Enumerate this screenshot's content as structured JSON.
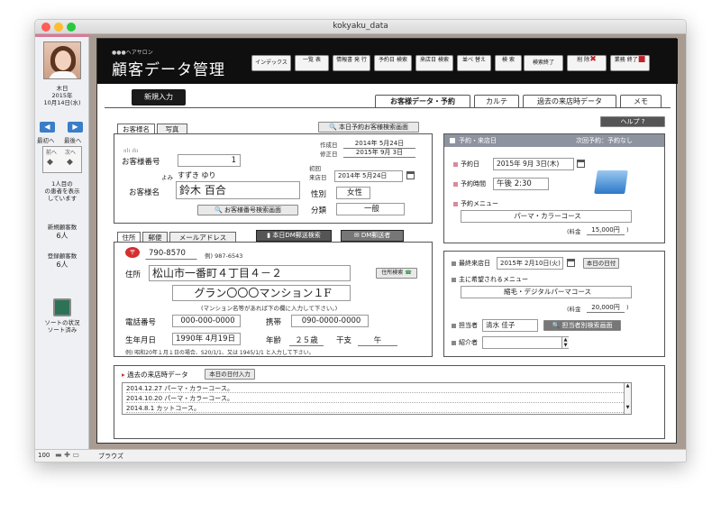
{
  "window": {
    "title": "kokyaku_data"
  },
  "sidebar": {
    "date_lines": [
      "木日",
      "2015年",
      "10月14日(水)"
    ],
    "nav_first": "最初へ",
    "nav_last": "最後へ",
    "nav_grid": [
      "前へ",
      "次へ"
    ],
    "note": [
      "1人目の",
      "の患者を表示",
      "しています"
    ],
    "new_count_label": "新規顧客数",
    "new_count": "6人",
    "reg_count_label": "登録顧客数",
    "reg_count": "6人",
    "sort_status": [
      "ソートの状況",
      "ソート済み"
    ]
  },
  "status": {
    "zoom": "100",
    "mode": "ブラウズ"
  },
  "header": {
    "brand": "●●●ヘアサロン",
    "title": "顧客データ管理",
    "buttons": [
      {
        "label": "インデックス"
      },
      {
        "label": "一覧 表"
      },
      {
        "label": "情報書 発 行"
      },
      {
        "label": "予約日 検索"
      },
      {
        "label": "来店日 検索"
      },
      {
        "label": "並べ 替え"
      },
      {
        "label": "検 索"
      },
      {
        "label": "検索終了"
      },
      {
        "label": "削 除"
      },
      {
        "label": "業務 終了"
      }
    ]
  },
  "new_entry": "新規入力",
  "tabs": [
    "お客様データ・予約",
    "カルテ",
    "過去の来店時データ",
    "メモ"
  ],
  "customer": {
    "subtabs": [
      "お客様名",
      "写真"
    ],
    "today_search": "本日予約お客様検索画面",
    "number_label": "お客様番号",
    "number": "1",
    "created_label": "作成日",
    "created": "2014年 5月24日",
    "modified_label": "修正日",
    "modified": "2015年 9月 3日",
    "first_visit_label": "初回",
    "first_visit_label2": "来店日",
    "first_visit": "2014年 5月24日",
    "yomi_label": "よみ",
    "yomi": "すずき ゆり",
    "name_label": "お客様名",
    "name": "鈴木 百合",
    "gender_label": "性別",
    "gender": "女性",
    "category_label": "分類",
    "category": "一般",
    "number_search": "お客様番号検索画面"
  },
  "address": {
    "subtabs": [
      "住所",
      "郵便",
      "メールアドレス"
    ],
    "dm_search": "本日DM郵送検索",
    "dm_sent": "DM郵送者",
    "postal": "790-8570",
    "postal_example": "例) 987-6543",
    "address_label": "住所",
    "address1": "松山市一番町４丁目４－２",
    "address_search": "住所検索",
    "address2": "グラン〇〇〇マンション１F",
    "address_note": "(マンション名等があれば下の欄に入力して下さい。)",
    "phone_label": "電話番号",
    "phone": "000-000-0000",
    "mobile_label": "携帯",
    "mobile": "090-0000-0000",
    "birth_label": "生年月日",
    "birth": "1990年 4月19日",
    "age_label": "年齢",
    "age": "２５歳",
    "eto_label": "干支",
    "eto": "午",
    "birth_example": "例) 昭和20年１月１日の場合、S20/1/1、又は 1945/1/1 と入力して下さい。"
  },
  "reservation": {
    "header_left": "予約・来店日",
    "header_right": "次回予約：予約なし",
    "date_label": "予約日",
    "date": "2015年 9月 3日(木)",
    "time_label": "予約時間",
    "time": "午後 2:30",
    "menu_label": "予約メニュー",
    "menu": "パーマ・カラーコース",
    "fee_label": "(料金",
    "fee": "15,000円",
    "fee_end": ")"
  },
  "visit": {
    "last_label": "最終来店日",
    "last": "2015年 2月10日(火)",
    "today_btn": "本日の日付",
    "wish_label": "主に希望されるメニュー",
    "wish": "縮毛・デジタルパーマコース",
    "fee_label": "(料金",
    "fee": "20,000円",
    "fee_end": ")",
    "staff_label": "担当者",
    "staff": "清水 佳子",
    "staff_search": "担当者別検索画面",
    "referrer_label": "紹介者",
    "referrer": ""
  },
  "history": {
    "title": "過去の来店時データ",
    "today_btn": "本日の日付入力",
    "rows": [
      "2014.12.27 パーマ・カラーコース。",
      "2014.10.20 パーマ・カラーコース。",
      "2014.8.1 カットコース。"
    ]
  },
  "help": "ヘルプ ?"
}
